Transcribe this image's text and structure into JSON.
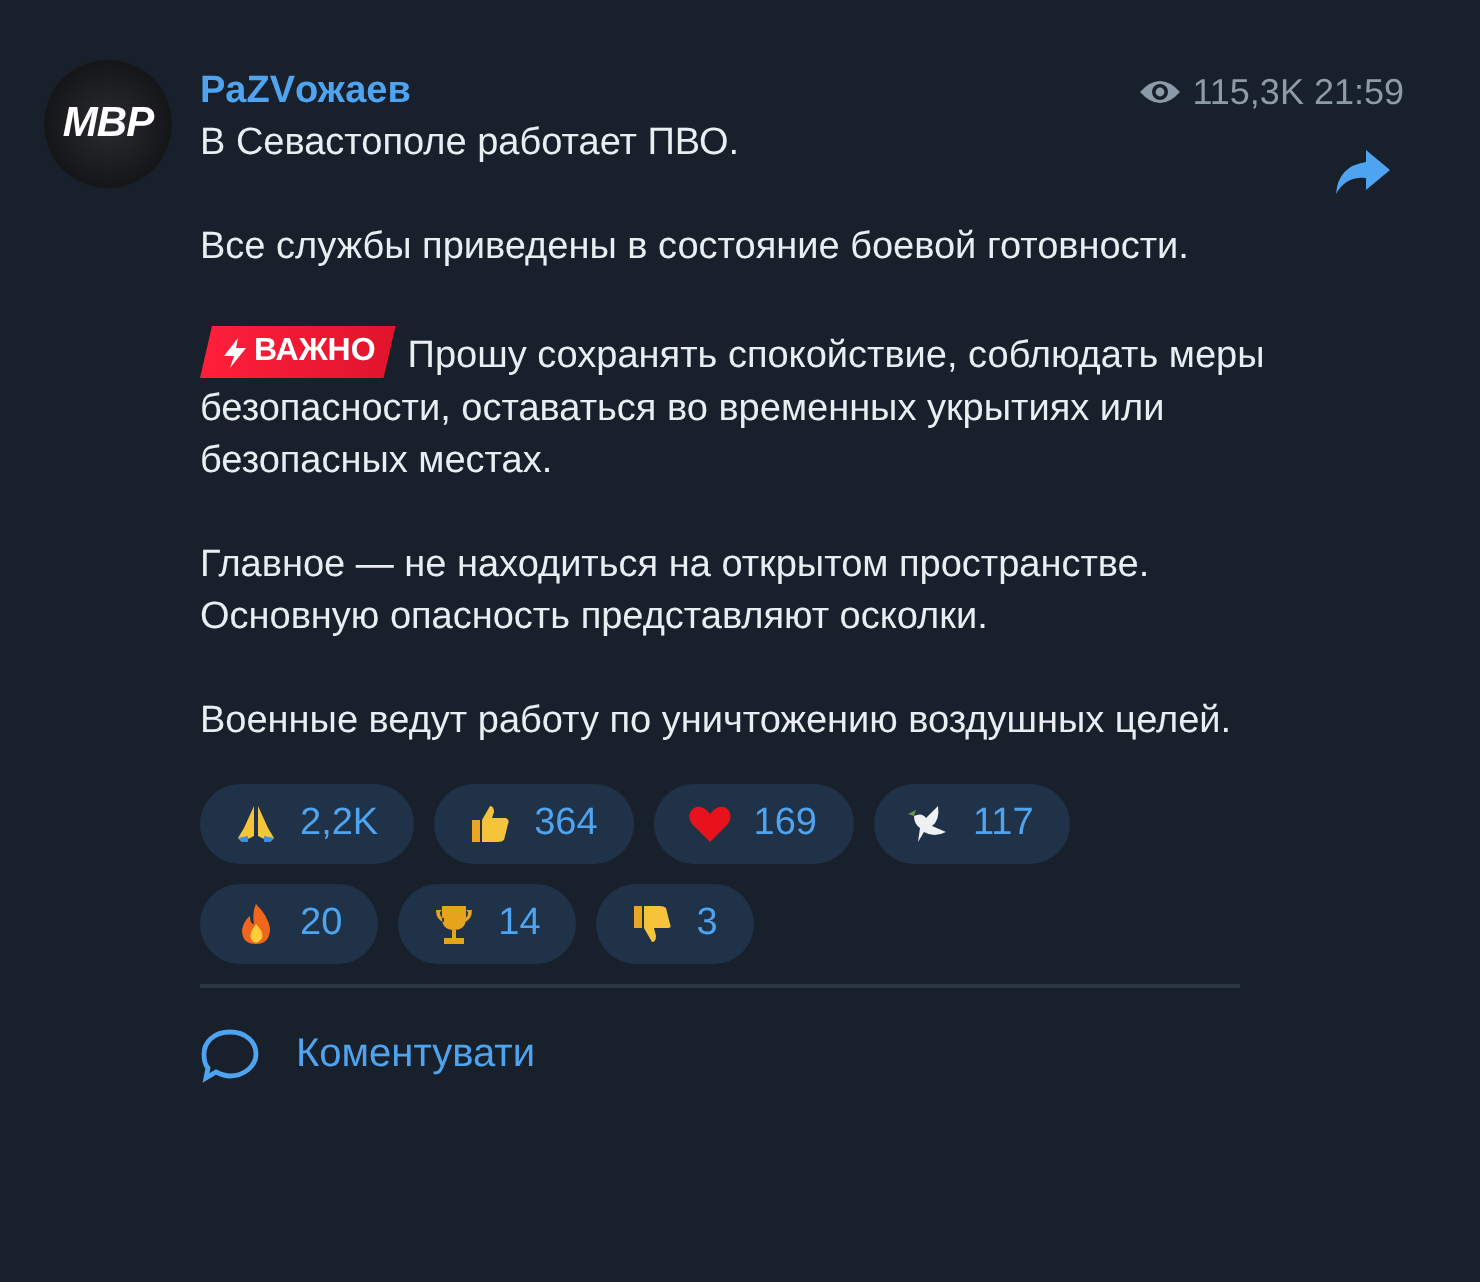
{
  "post": {
    "avatar_text": "MBP",
    "channel": "PaZVожаев",
    "views": "115,3K",
    "time": "21:59",
    "paragraphs": [
      {
        "text": "В Севастополе работает ПВО."
      },
      {
        "text": "Все службы приведены в состояние боевой готовности."
      },
      {
        "badge": "ВАЖНО",
        "text": "Прошу сохранять спокойствие, соблюдать меры безопасности, оставаться во временных укрытиях или безопасных местах."
      },
      {
        "text": "Главное — не находиться на открытом пространстве. Основную опасность представляют осколки."
      },
      {
        "text": "Военные ведут работу по уничтожению воздушных целей."
      }
    ],
    "reactions": [
      {
        "kind": "pray",
        "count": "2,2K"
      },
      {
        "kind": "thumbs-up",
        "count": "364"
      },
      {
        "kind": "heart",
        "count": "169"
      },
      {
        "kind": "dove",
        "count": "117"
      },
      {
        "kind": "fire",
        "count": "20"
      },
      {
        "kind": "trophy",
        "count": "14"
      },
      {
        "kind": "thumbs-down",
        "count": "3"
      }
    ],
    "comment_label": "Коментувати"
  }
}
